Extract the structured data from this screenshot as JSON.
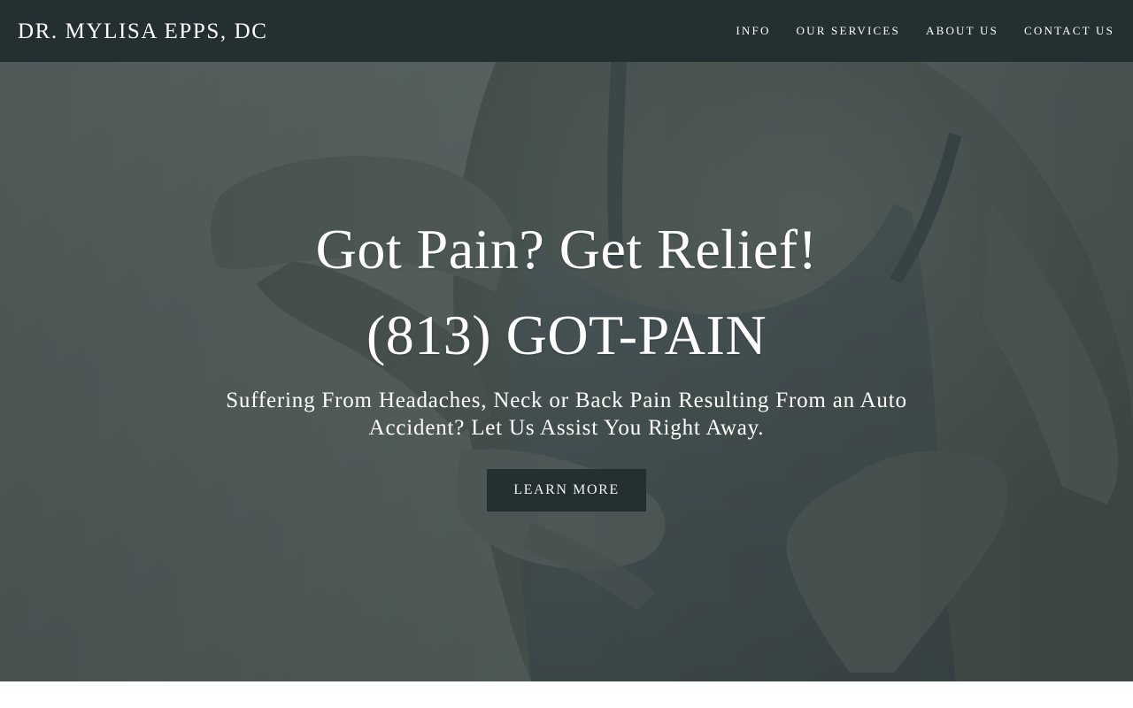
{
  "header": {
    "brand": "DR. MYLISA EPPS, DC",
    "nav": [
      {
        "label": "INFO"
      },
      {
        "label": "OUR SERVICES"
      },
      {
        "label": "ABOUT US"
      },
      {
        "label": "CONTACT US"
      }
    ]
  },
  "hero": {
    "headline": "Got Pain? Get Relief!",
    "phone": "(813) GOT-PAIN",
    "subtext": "Suffering From Headaches, Neck or Back Pain Resulting From an Auto Accident? Let Us Assist You Right Away.",
    "cta_label": "LEARN MORE"
  },
  "colors": {
    "nav_background": "#232f31",
    "hero_overlay": "#56615f",
    "text": "#ffffff"
  }
}
